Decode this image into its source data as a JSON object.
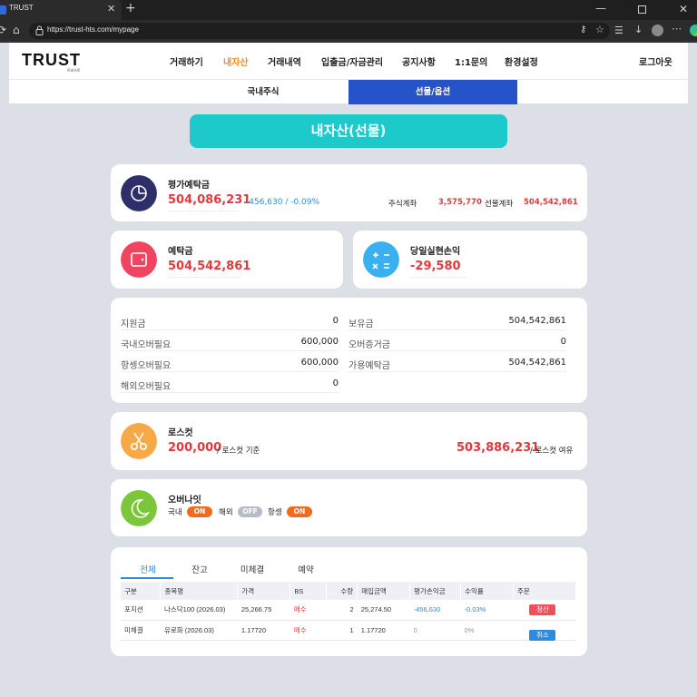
{
  "browser": {
    "tab_title": "TRUST",
    "url": "https://trust-hts.com/mypage",
    "close_glyph": "✕",
    "new_tab_glyph": "+",
    "min_glyph": "—",
    "win_close_glyph": "✕"
  },
  "header": {
    "logo": "TRUST",
    "logo_sub": "트러스트",
    "nav": [
      "거래하기",
      "내자산",
      "거래내역",
      "입출금/자금관리",
      "공지사항",
      "1:1문의",
      "환경설정"
    ],
    "logout": "로그아웃"
  },
  "subtabs": [
    "국내주식",
    "선물/옵션"
  ],
  "banner": "내자산(선물)",
  "eval": {
    "label": "평가예탁금",
    "value": "504,086,231",
    "change": "-456,630 / -0.09%",
    "stock_label": "주식계좌",
    "stock_value": "3,575,770",
    "futures_label": "선물계좌",
    "futures_value": "504,542,861"
  },
  "deposit": {
    "label": "예탁금",
    "value": "504,542,861"
  },
  "daily_pnl": {
    "label": "당일실현손익",
    "value": "-29,580"
  },
  "detail": {
    "left": [
      {
        "label": "지원금",
        "value": "0"
      },
      {
        "label": "국내오버필요",
        "value": "600,000"
      },
      {
        "label": "항셍오버필요",
        "value": "600,000"
      },
      {
        "label": "해외오버필요",
        "value": "0"
      }
    ],
    "right": [
      {
        "label": "보유금",
        "value": "504,542,861"
      },
      {
        "label": "오버증거금",
        "value": "0"
      },
      {
        "label": "가용예탁금",
        "value": "504,542,861"
      }
    ]
  },
  "losscut": {
    "label": "로스컷",
    "value": "200,000",
    "value_suffix": "/ 로스컷 기준",
    "margin": "503,886,231",
    "margin_suffix": "/ 로스컷 여유"
  },
  "overnight": {
    "label": "오버나잇",
    "items": [
      {
        "name": "국내",
        "state": "ON"
      },
      {
        "name": "해외",
        "state": "OFF"
      },
      {
        "name": "항셍",
        "state": "ON"
      }
    ]
  },
  "positions": {
    "tabs": [
      "전체",
      "잔고",
      "미체결",
      "예약"
    ],
    "columns": [
      "구분",
      "종목명",
      "가격",
      "BS",
      "수량",
      "매입금액",
      "평가손익금",
      "수익률",
      "주문"
    ],
    "rows": [
      {
        "type": "포지션",
        "name": "나스닥100 (2026.03)",
        "price": "25,266.75",
        "bs": "매수",
        "qty": "2",
        "amount": "25,274.50",
        "pnl": "-456,630",
        "rate": "-0.03%",
        "action": "청산"
      },
      {
        "type": "미체결",
        "name": "유로화 (2026.03)",
        "price": "1.17720",
        "bs": "매수",
        "qty": "1",
        "amount": "1.17720",
        "pnl": "0",
        "rate": "0%",
        "action": "취소"
      }
    ]
  },
  "colors": {
    "accent": "#2653c9",
    "banner": "#1ccacb",
    "negative": "#e4393c",
    "on": "#f26b1d"
  }
}
